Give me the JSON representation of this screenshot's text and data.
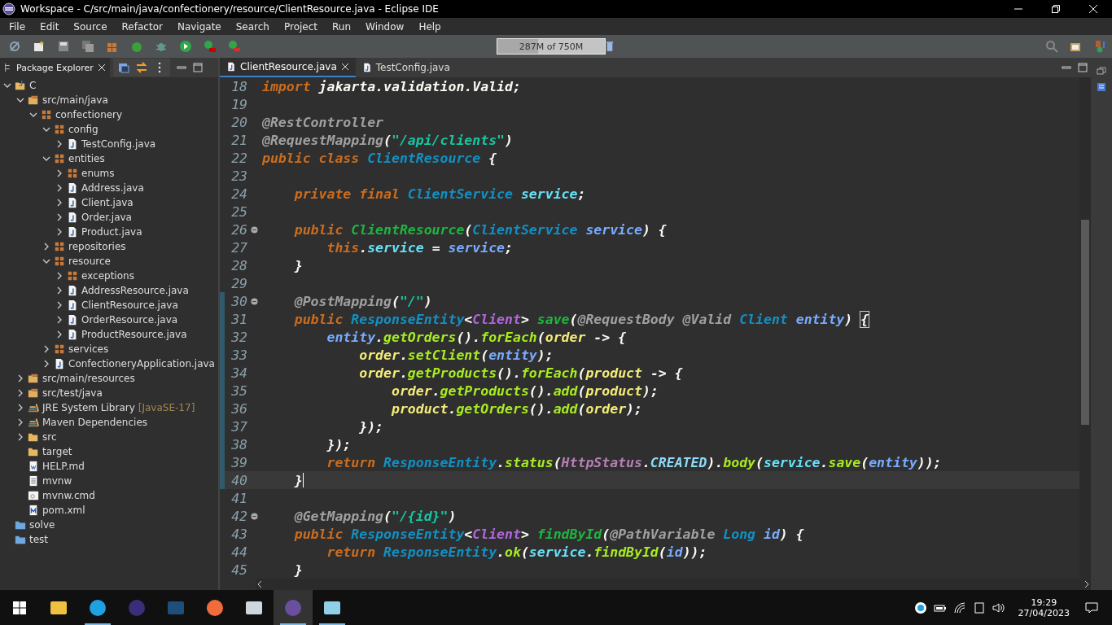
{
  "window": {
    "title": "Workspace - C/src/main/java/confectionery/resource/ClientResource.java - Eclipse IDE"
  },
  "menu": [
    "File",
    "Edit",
    "Source",
    "Refactor",
    "Navigate",
    "Search",
    "Project",
    "Run",
    "Window",
    "Help"
  ],
  "heap_status": {
    "text": "287M of 750M",
    "level": 0.38
  },
  "package_explorer": {
    "title": "Package Explorer",
    "tree": [
      {
        "label": "C",
        "kind": "project",
        "expanded": true,
        "children": [
          {
            "label": "src/main/java",
            "kind": "source-folder",
            "expanded": true,
            "children": [
              {
                "label": "confectionery",
                "kind": "package",
                "expanded": true,
                "children": [
                  {
                    "label": "config",
                    "kind": "package",
                    "expanded": true,
                    "children": [
                      {
                        "label": "TestConfig.java",
                        "kind": "java",
                        "expanded": false
                      }
                    ]
                  },
                  {
                    "label": "entities",
                    "kind": "package",
                    "expanded": true,
                    "children": [
                      {
                        "label": "enums",
                        "kind": "package",
                        "expanded": false
                      },
                      {
                        "label": "Address.java",
                        "kind": "java",
                        "expanded": false
                      },
                      {
                        "label": "Client.java",
                        "kind": "java",
                        "expanded": false
                      },
                      {
                        "label": "Order.java",
                        "kind": "java",
                        "expanded": false
                      },
                      {
                        "label": "Product.java",
                        "kind": "java",
                        "expanded": false
                      }
                    ]
                  },
                  {
                    "label": "repositories",
                    "kind": "package",
                    "expanded": false
                  },
                  {
                    "label": "resource",
                    "kind": "package",
                    "expanded": true,
                    "children": [
                      {
                        "label": "exceptions",
                        "kind": "package",
                        "expanded": false
                      },
                      {
                        "label": "AddressResource.java",
                        "kind": "java",
                        "expanded": false
                      },
                      {
                        "label": "ClientResource.java",
                        "kind": "java",
                        "expanded": false
                      },
                      {
                        "label": "OrderResource.java",
                        "kind": "java",
                        "expanded": false
                      },
                      {
                        "label": "ProductResource.java",
                        "kind": "java",
                        "expanded": false
                      }
                    ]
                  },
                  {
                    "label": "services",
                    "kind": "package",
                    "expanded": false
                  },
                  {
                    "label": "ConfectioneryApplication.java",
                    "kind": "java",
                    "expanded": false
                  }
                ]
              }
            ]
          },
          {
            "label": "src/main/resources",
            "kind": "source-folder",
            "expanded": false
          },
          {
            "label": "src/test/java",
            "kind": "source-folder",
            "expanded": false
          },
          {
            "label": "JRE System Library",
            "decoration": "[JavaSE-17]",
            "kind": "library",
            "expanded": false
          },
          {
            "label": "Maven Dependencies",
            "kind": "library",
            "expanded": false
          },
          {
            "label": "src",
            "kind": "folder",
            "expanded": false
          },
          {
            "label": "target",
            "kind": "folder"
          },
          {
            "label": "HELP.md",
            "kind": "doc"
          },
          {
            "label": "mvnw",
            "kind": "text"
          },
          {
            "label": "mvnw.cmd",
            "kind": "cmd"
          },
          {
            "label": "pom.xml",
            "kind": "maven"
          }
        ]
      },
      {
        "label": "solve",
        "kind": "project-folder"
      },
      {
        "label": "test",
        "kind": "project-folder"
      }
    ]
  },
  "editor_tabs": [
    {
      "label": "ClientResource.java",
      "selected": true
    },
    {
      "label": "TestConfig.java",
      "selected": false
    }
  ],
  "code_lines": [
    {
      "number": "18",
      "tokens": [
        {
          "kind": "kw",
          "text": "import"
        },
        {
          "kind": "pl",
          "text": " jakarta.validation.Valid;"
        }
      ]
    },
    {
      "number": "19"
    },
    {
      "number": "20",
      "tokens": [
        {
          "kind": "ann",
          "text": "@RestController"
        }
      ]
    },
    {
      "number": "21",
      "tokens": [
        {
          "kind": "ann",
          "text": "@RequestMapping"
        },
        {
          "kind": "pl",
          "text": "("
        },
        {
          "kind": "str",
          "text": "\"/api/clients\""
        },
        {
          "kind": "pl",
          "text": ")"
        }
      ]
    },
    {
      "number": "22",
      "tokens": [
        {
          "kind": "kw",
          "text": "public class "
        },
        {
          "kind": "type",
          "text": "ClientResource"
        },
        {
          "kind": "pl",
          "text": " {"
        }
      ]
    },
    {
      "number": "23"
    },
    {
      "number": "24",
      "tokens": [
        {
          "kind": "kw",
          "text": "    private final "
        },
        {
          "kind": "type",
          "text": "ClientService "
        },
        {
          "kind": "field",
          "text": "service"
        },
        {
          "kind": "pl",
          "text": ";"
        }
      ]
    },
    {
      "number": "25"
    },
    {
      "number": "26",
      "fold": true,
      "tokens": [
        {
          "kind": "kw",
          "text": "    public "
        },
        {
          "kind": "decl",
          "text": "ClientResource"
        },
        {
          "kind": "pl",
          "text": "("
        },
        {
          "kind": "type",
          "text": "ClientService "
        },
        {
          "kind": "param",
          "text": "service"
        },
        {
          "kind": "pl",
          "text": ") {"
        }
      ]
    },
    {
      "number": "27",
      "tokens": [
        {
          "kind": "kw",
          "text": "        this"
        },
        {
          "kind": "pl",
          "text": "."
        },
        {
          "kind": "field",
          "text": "service"
        },
        {
          "kind": "pl",
          "text": " = "
        },
        {
          "kind": "param",
          "text": "service"
        },
        {
          "kind": "pl",
          "text": ";"
        }
      ]
    },
    {
      "number": "28",
      "tokens": [
        {
          "kind": "pl",
          "text": "    }"
        }
      ]
    },
    {
      "number": "29"
    },
    {
      "number": "30",
      "fold": true,
      "changed": true,
      "tokens": [
        {
          "kind": "ann",
          "text": "    @PostMapping"
        },
        {
          "kind": "pl",
          "text": "("
        },
        {
          "kind": "str",
          "text": "\"/\""
        },
        {
          "kind": "pl",
          "text": ")"
        }
      ]
    },
    {
      "number": "31",
      "changed": true,
      "tokens": [
        {
          "kind": "kw",
          "text": "    public "
        },
        {
          "kind": "type",
          "text": "ResponseEntity"
        },
        {
          "kind": "pl",
          "text": "<"
        },
        {
          "kind": "typearg",
          "text": "Client"
        },
        {
          "kind": "pl",
          "text": "> "
        },
        {
          "kind": "decl",
          "text": "save"
        },
        {
          "kind": "pl",
          "text": "("
        },
        {
          "kind": "ann",
          "text": "@RequestBody @Valid "
        },
        {
          "kind": "type",
          "text": "Client "
        },
        {
          "kind": "param",
          "text": "entity"
        },
        {
          "kind": "pl",
          "text": ") "
        },
        {
          "kind": "bracket",
          "text": "{"
        }
      ]
    },
    {
      "number": "32",
      "changed": true,
      "tokens": [
        {
          "kind": "param",
          "text": "        entity"
        },
        {
          "kind": "pl",
          "text": "."
        },
        {
          "kind": "call",
          "text": "getOrders"
        },
        {
          "kind": "pl",
          "text": "()."
        },
        {
          "kind": "call",
          "text": "forEach"
        },
        {
          "kind": "pl",
          "text": "("
        },
        {
          "kind": "local",
          "text": "order"
        },
        {
          "kind": "pl",
          "text": " -> {"
        }
      ]
    },
    {
      "number": "33",
      "changed": true,
      "tokens": [
        {
          "kind": "local",
          "text": "            order"
        },
        {
          "kind": "pl",
          "text": "."
        },
        {
          "kind": "call",
          "text": "setClient"
        },
        {
          "kind": "pl",
          "text": "("
        },
        {
          "kind": "param",
          "text": "entity"
        },
        {
          "kind": "pl",
          "text": ");"
        }
      ]
    },
    {
      "number": "34",
      "changed": true,
      "tokens": [
        {
          "kind": "local",
          "text": "            order"
        },
        {
          "kind": "pl",
          "text": "."
        },
        {
          "kind": "call",
          "text": "getProducts"
        },
        {
          "kind": "pl",
          "text": "()."
        },
        {
          "kind": "call",
          "text": "forEach"
        },
        {
          "kind": "pl",
          "text": "("
        },
        {
          "kind": "local",
          "text": "product"
        },
        {
          "kind": "pl",
          "text": " -> {"
        }
      ]
    },
    {
      "number": "35",
      "changed": true,
      "tokens": [
        {
          "kind": "local",
          "text": "                order"
        },
        {
          "kind": "pl",
          "text": "."
        },
        {
          "kind": "call",
          "text": "getProducts"
        },
        {
          "kind": "pl",
          "text": "()."
        },
        {
          "kind": "call",
          "text": "add"
        },
        {
          "kind": "pl",
          "text": "("
        },
        {
          "kind": "local",
          "text": "product"
        },
        {
          "kind": "pl",
          "text": ");"
        }
      ]
    },
    {
      "number": "36",
      "changed": true,
      "tokens": [
        {
          "kind": "local",
          "text": "                product"
        },
        {
          "kind": "pl",
          "text": "."
        },
        {
          "kind": "call",
          "text": "getOrders"
        },
        {
          "kind": "pl",
          "text": "()."
        },
        {
          "kind": "call",
          "text": "add"
        },
        {
          "kind": "pl",
          "text": "("
        },
        {
          "kind": "local",
          "text": "order"
        },
        {
          "kind": "pl",
          "text": ");"
        }
      ]
    },
    {
      "number": "37",
      "changed": true,
      "tokens": [
        {
          "kind": "pl",
          "text": "            });"
        }
      ]
    },
    {
      "number": "38",
      "changed": true,
      "tokens": [
        {
          "kind": "pl",
          "text": "        });"
        }
      ]
    },
    {
      "number": "39",
      "changed": true,
      "tokens": [
        {
          "kind": "kw",
          "text": "        return "
        },
        {
          "kind": "type",
          "text": "ResponseEntity"
        },
        {
          "kind": "pl",
          "text": "."
        },
        {
          "kind": "call",
          "text": "status"
        },
        {
          "kind": "pl",
          "text": "("
        },
        {
          "kind": "enumtype",
          "text": "HttpStatus"
        },
        {
          "kind": "pl",
          "text": "."
        },
        {
          "kind": "const",
          "text": "CREATED"
        },
        {
          "kind": "pl",
          "text": ")."
        },
        {
          "kind": "call",
          "text": "body"
        },
        {
          "kind": "pl",
          "text": "("
        },
        {
          "kind": "field",
          "text": "service"
        },
        {
          "kind": "pl",
          "text": "."
        },
        {
          "kind": "call",
          "text": "save"
        },
        {
          "kind": "pl",
          "text": "("
        },
        {
          "kind": "param",
          "text": "entity"
        },
        {
          "kind": "pl",
          "text": "));"
        }
      ]
    },
    {
      "number": "40",
      "changed": true,
      "current": true,
      "tokens": [
        {
          "kind": "pl",
          "text": "    }"
        }
      ]
    },
    {
      "number": "41"
    },
    {
      "number": "42",
      "fold": true,
      "tokens": [
        {
          "kind": "ann",
          "text": "    @GetMapping"
        },
        {
          "kind": "pl",
          "text": "("
        },
        {
          "kind": "str",
          "text": "\"/{id}\""
        },
        {
          "kind": "pl",
          "text": ")"
        }
      ]
    },
    {
      "number": "43",
      "tokens": [
        {
          "kind": "kw",
          "text": "    public "
        },
        {
          "kind": "type",
          "text": "ResponseEntity"
        },
        {
          "kind": "pl",
          "text": "<"
        },
        {
          "kind": "typearg",
          "text": "Client"
        },
        {
          "kind": "pl",
          "text": "> "
        },
        {
          "kind": "decl",
          "text": "findById"
        },
        {
          "kind": "pl",
          "text": "("
        },
        {
          "kind": "ann",
          "text": "@PathVariable "
        },
        {
          "kind": "type",
          "text": "Long "
        },
        {
          "kind": "param",
          "text": "id"
        },
        {
          "kind": "pl",
          "text": ") {"
        }
      ]
    },
    {
      "number": "44",
      "tokens": [
        {
          "kind": "kw",
          "text": "        return "
        },
        {
          "kind": "type",
          "text": "ResponseEntity"
        },
        {
          "kind": "pl",
          "text": "."
        },
        {
          "kind": "call",
          "text": "ok"
        },
        {
          "kind": "pl",
          "text": "("
        },
        {
          "kind": "field",
          "text": "service"
        },
        {
          "kind": "pl",
          "text": "."
        },
        {
          "kind": "call",
          "text": "findById"
        },
        {
          "kind": "pl",
          "text": "("
        },
        {
          "kind": "param",
          "text": "id"
        },
        {
          "kind": "pl",
          "text": "));"
        }
      ]
    },
    {
      "number": "45",
      "tokens": [
        {
          "kind": "pl",
          "text": "    }"
        }
      ]
    }
  ],
  "taskbar": {
    "apps": [
      {
        "kind": "files",
        "running": false,
        "selected": false
      },
      {
        "kind": "edge",
        "running": true,
        "selected": false
      },
      {
        "kind": "eclipse",
        "running": false,
        "selected": false
      },
      {
        "kind": "workbench",
        "running": false,
        "selected": false
      },
      {
        "kind": "postman",
        "running": false,
        "selected": false
      },
      {
        "kind": "monitor",
        "running": false,
        "selected": false
      },
      {
        "kind": "ide",
        "running": true,
        "selected": true
      },
      {
        "kind": "notes",
        "running": true,
        "selected": false
      }
    ],
    "time": "19:29",
    "date": "27/04/2023"
  }
}
